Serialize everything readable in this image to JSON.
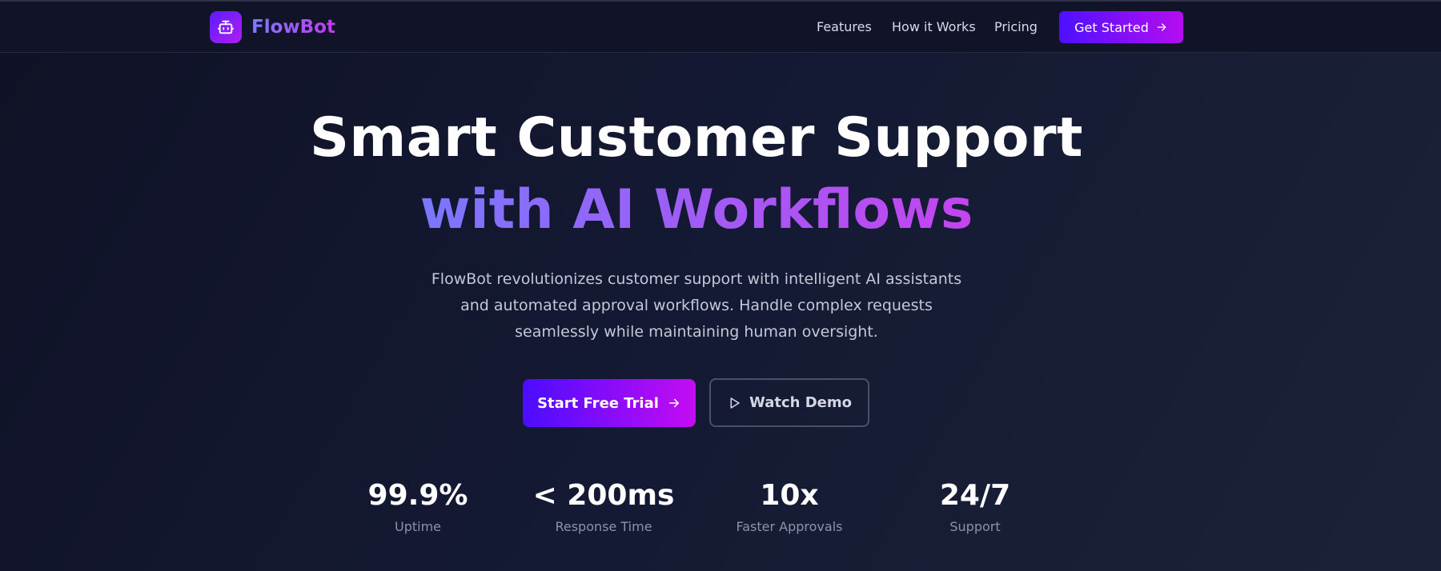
{
  "nav": {
    "brand": "FlowBot",
    "logo_icon": "robot-icon",
    "links": [
      "Features",
      "How it Works",
      "Pricing"
    ],
    "cta_label": "Get Started",
    "cta_icon": "arrow-right-icon"
  },
  "hero": {
    "title_line1": "Smart Customer Support",
    "title_line2": "with AI Workflows",
    "description": "FlowBot revolutionizes customer support with intelligent AI assistants and automated approval workflows. Handle complex requests seamlessly while maintaining human oversight.",
    "primary_button": "Start Free Trial",
    "primary_icon": "arrow-right-icon",
    "secondary_button": "Watch Demo",
    "secondary_icon": "play-icon"
  },
  "stats": [
    {
      "value": "99.9%",
      "label": "Uptime"
    },
    {
      "value": "< 200ms",
      "label": "Response Time"
    },
    {
      "value": "10x",
      "label": "Faster Approvals"
    },
    {
      "value": "24/7",
      "label": "Support"
    }
  ],
  "colors": {
    "background": "#141933",
    "navbar": "#111428",
    "accent_start": "#4d10ff",
    "accent_end": "#c40cf2",
    "gradient_text_start": "#7a78ff",
    "gradient_text_end": "#c445f0"
  }
}
